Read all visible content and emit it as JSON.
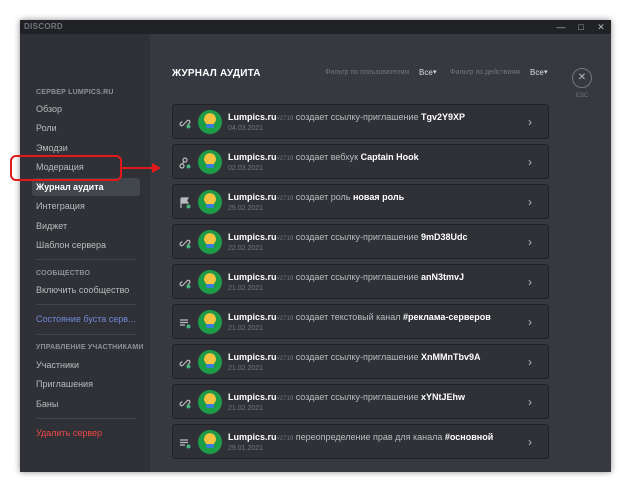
{
  "window": {
    "brand": "DISCORD",
    "controls": {
      "minimize": "—",
      "maximize": "□",
      "close": "✕"
    }
  },
  "sidebar": {
    "server_header": "СЕРВЕР LUMPICS.RU",
    "items": [
      {
        "label": "Обзор"
      },
      {
        "label": "Роли"
      },
      {
        "label": "Эмодзи"
      },
      {
        "label": "Модерация"
      },
      {
        "label": "Журнал аудита"
      },
      {
        "label": "Интеграция"
      },
      {
        "label": "Виджет"
      },
      {
        "label": "Шаблон сервера"
      }
    ],
    "community_header": "СООБЩЕСТВО",
    "enable_community": "Включить сообщество",
    "boost_status": "Состояние буста серв...",
    "members_header": "УПРАВЛЕНИЕ УЧАСТНИКАМИ",
    "members_items": [
      {
        "label": "Участники"
      },
      {
        "label": "Приглашения"
      },
      {
        "label": "Баны"
      }
    ],
    "delete_server": "Удалить сервер"
  },
  "main": {
    "title": "ЖУРНАЛ АУДИТА",
    "filter_user_label": "Фильтр по пользователям",
    "filter_user_value": "Все",
    "filter_action_label": "Фильтр по действиям",
    "filter_action_value": "Все",
    "caret": "▾",
    "esc_icon": "✕",
    "esc_label": "ESC"
  },
  "entries": [
    {
      "icon": "link-icon",
      "user": "Lumpics.ru",
      "discriminator": "#2719",
      "action": " создает ссылку-приглашение ",
      "target": "Tgv2Y9XP",
      "date": "04.03.2021"
    },
    {
      "icon": "webhook-icon",
      "user": "Lumpics.ru",
      "discriminator": "#2719",
      "action": " создает вебхук ",
      "target": "Captain Hook",
      "date": "02.03.2021"
    },
    {
      "icon": "flag-icon",
      "user": "Lumpics.ru",
      "discriminator": "#2719",
      "action": " создает роль ",
      "target": "новая роль",
      "date": "25.02.2021"
    },
    {
      "icon": "link-icon",
      "user": "Lumpics.ru",
      "discriminator": "#2719",
      "action": " создает ссылку-приглашение ",
      "target": "9mD38Udc",
      "date": "22.02.2021"
    },
    {
      "icon": "link-icon",
      "user": "Lumpics.ru",
      "discriminator": "#2719",
      "action": " создает ссылку-приглашение ",
      "target": "anN3tmvJ",
      "date": "21.02.2021"
    },
    {
      "icon": "channel-icon",
      "user": "Lumpics.ru",
      "discriminator": "#2719",
      "action": " создает текстовый канал ",
      "target": "#реклама-серверов",
      "date": "21.02.2021"
    },
    {
      "icon": "link-icon",
      "user": "Lumpics.ru",
      "discriminator": "#2719",
      "action": " создает ссылку-приглашение ",
      "target": "XnMMnTbv9A",
      "date": "21.02.2021"
    },
    {
      "icon": "link-icon",
      "user": "Lumpics.ru",
      "discriminator": "#2719",
      "action": " создает ссылку-приглашение ",
      "target": "xYNtJEhw",
      "date": "21.02.2021"
    },
    {
      "icon": "channel-icon",
      "user": "Lumpics.ru",
      "discriminator": "#2719",
      "action": " переопределение прав для канала ",
      "target": "#основной",
      "date": "29.01.2021"
    }
  ],
  "colors": {
    "window_bg": "#36393f",
    "sidebar_bg": "#2f3136",
    "titlebar_bg": "#202225",
    "highlight_red": "#e01a1a",
    "accent_blue": "#7289da",
    "danger_red": "#f04747",
    "avatar_green": "#1d9c47"
  }
}
